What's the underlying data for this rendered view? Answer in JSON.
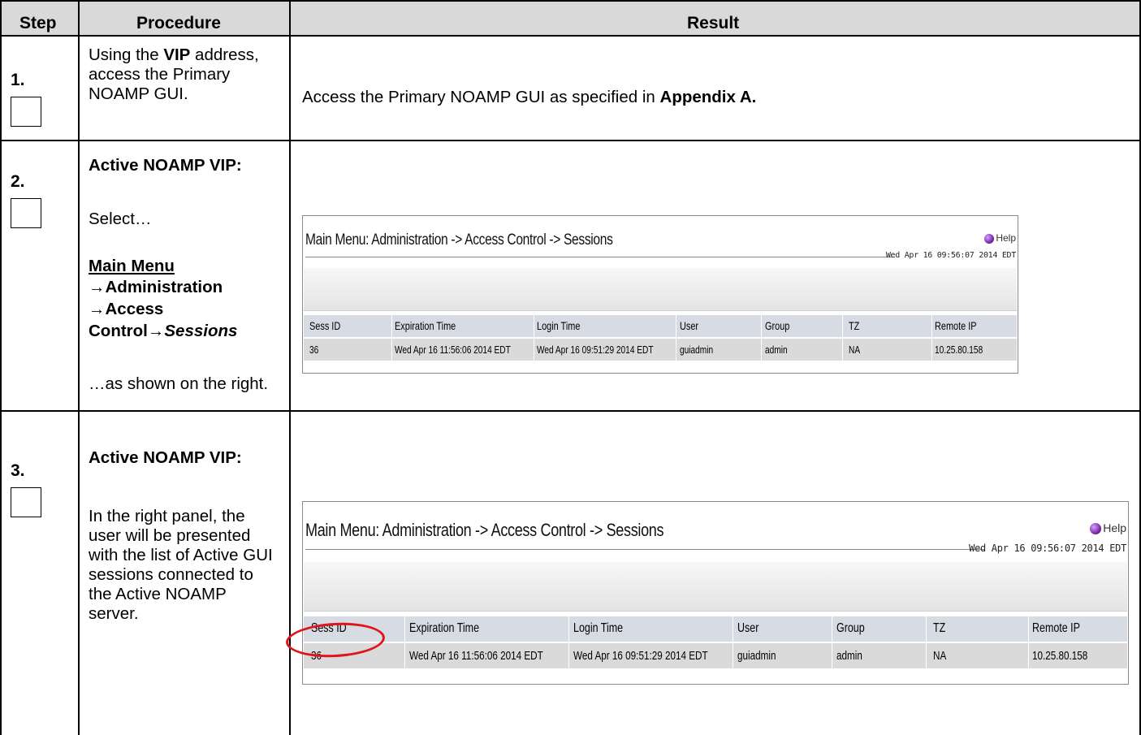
{
  "table": {
    "headers": {
      "step": "Step",
      "procedure": "Procedure",
      "result": "Result"
    },
    "rows": [
      {
        "step": "1.",
        "procedure": {
          "pre": "Using the ",
          "bold": "VIP",
          "post": " address, access the Primary NOAMP GUI."
        },
        "result": {
          "pre": "Access the Primary NOAMP GUI as specified in ",
          "bold": "Appendix A."
        }
      },
      {
        "step": "2.",
        "procedure": {
          "heading": "Active NOAMP VIP:",
          "select": "Select…",
          "menu_main": "Main Menu",
          "menu_admin": "→Administration",
          "menu_access": "→Access",
          "menu_control": "Control→",
          "menu_sessions": "Sessions",
          "tail": "…as shown on the right."
        }
      },
      {
        "step": "3.",
        "procedure": {
          "heading": "Active NOAMP VIP:",
          "body": "In the right panel, the user will be presented with the list of Active GUI sessions connected to the Active NOAMP server."
        }
      }
    ]
  },
  "gui": {
    "title": "Main Menu: Administration -> Access Control -> Sessions",
    "help": "Help",
    "timestamp": "Wed Apr 16 09:56:07 2014 EDT",
    "columns": [
      "Sess ID",
      "Expiration Time",
      "Login Time",
      "User",
      "Group",
      "TZ",
      "Remote IP"
    ],
    "row": [
      "36",
      "Wed Apr 16 11:56:06 2014 EDT",
      "Wed Apr 16 09:51:29 2014 EDT",
      "guiadmin",
      "admin",
      "NA",
      "10.25.80.158"
    ]
  },
  "colors": {
    "header_fill": "#d9d9d9",
    "highlight": "#e0141b"
  }
}
